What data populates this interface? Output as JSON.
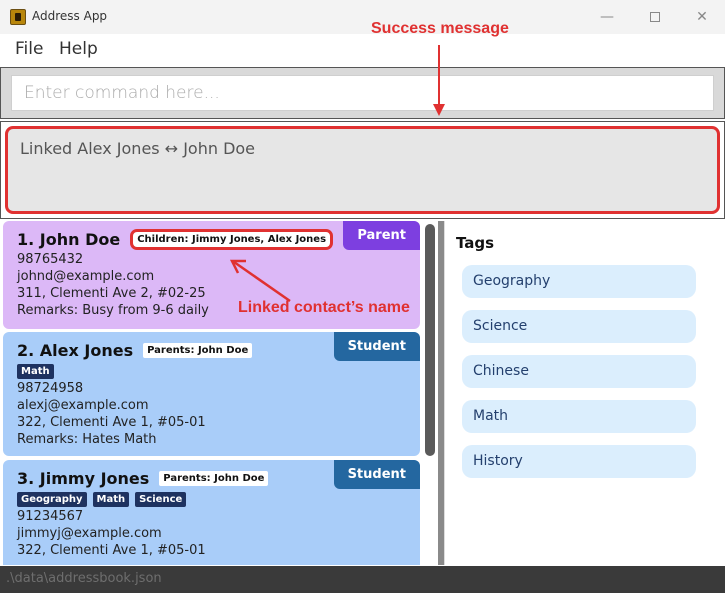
{
  "window": {
    "title": "Address App",
    "controls": {
      "minimize": "—",
      "close": "✕"
    }
  },
  "menu": {
    "file": "File",
    "help": "Help"
  },
  "command": {
    "placeholder": "Enter command here..."
  },
  "result": {
    "message": "Linked Alex Jones ↔ John Doe"
  },
  "annotations": {
    "success_message": "Success message",
    "linked_name": "Linked contact’s name",
    "accent_color": "#e03131"
  },
  "persons": [
    {
      "index_name": "1. John Doe",
      "relation": "Children: Jimmy Jones, Alex Jones",
      "role": "Parent",
      "tags": [],
      "phone": "98765432",
      "email": "johnd@example.com",
      "address": "311, Clementi Ave 2, #02-25",
      "remarks": "Remarks: Busy from 9-6 daily",
      "card_color": "#dcb8f7"
    },
    {
      "index_name": "2. Alex Jones",
      "relation": "Parents: John Doe",
      "role": "Student",
      "tags": [
        "Math"
      ],
      "phone": "98724958",
      "email": "alexj@example.com",
      "address": "322, Clementi Ave 1, #05-01",
      "remarks": "Remarks: Hates Math",
      "card_color": "#a9cdf9"
    },
    {
      "index_name": "3. Jimmy Jones",
      "relation": "Parents: John Doe",
      "role": "Student",
      "tags": [
        "Geography",
        "Math",
        "Science"
      ],
      "phone": "91234567",
      "email": "jimmyj@example.com",
      "address": "322, Clementi Ave 1, #05-01",
      "remarks": "",
      "card_color": "#a9cdf9"
    }
  ],
  "tags_panel": {
    "title": "Tags",
    "items": [
      "Geography",
      "Science",
      "Chinese",
      "Math",
      "History"
    ]
  },
  "status": {
    "file_path": ".\\data\\addressbook.json"
  }
}
